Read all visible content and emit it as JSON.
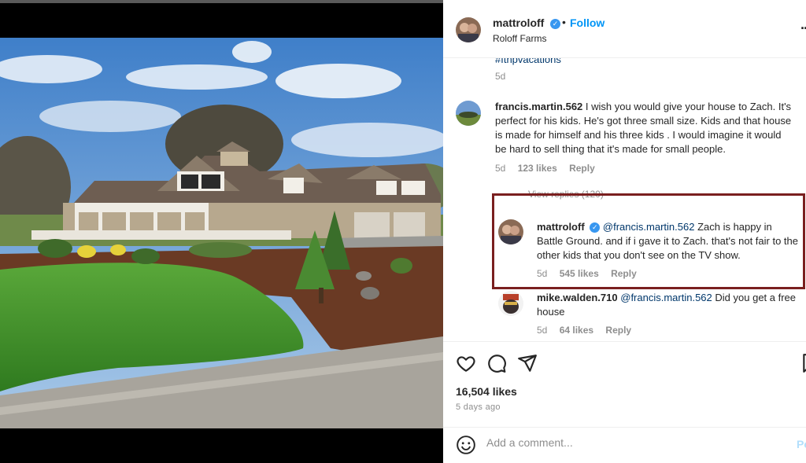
{
  "post": {
    "author": "mattroloff",
    "location": "Roloff Farms",
    "follow_label": "Follow",
    "dot": "•",
    "more_label": "···",
    "verified_mark": "✓"
  },
  "caption_tail": {
    "hashtag": "#fthpvacations",
    "time": "5d"
  },
  "comments": [
    {
      "username": "francis.martin.562",
      "text": " I wish you would give your house to Zach. It's perfect for his kids. He's got three small size. Kids and that house is made for himself and his three kids . I would imagine it would be hard to sell thing that it's made for small people.",
      "time": "5d",
      "likes": "123 likes",
      "reply": "Reply"
    },
    {
      "username": "mattroloff",
      "mention": "@francis.martin.562",
      "text": " Zach is happy in Battle Ground. and if i gave it to Zach. that's not fair to the other kids that you don't see on the TV show.",
      "time": "5d",
      "likes": "545 likes",
      "reply": "Reply"
    },
    {
      "username": "mike.walden.710",
      "mention": "@francis.martin.562",
      "text": " Did you get a free house",
      "time": "5d",
      "likes": "64 likes",
      "reply": "Reply"
    }
  ],
  "view_replies": "View replies (120)",
  "actions": {
    "icons": [
      "heart-icon",
      "comment-icon",
      "share-icon",
      "bookmark-icon"
    ]
  },
  "likes_count": "16,504 likes",
  "posted_ago": "5 days ago",
  "add_comment": {
    "placeholder": "Add a comment...",
    "post_label": "Post"
  },
  "colors": {
    "accent": "#0095f6",
    "highlight_border": "#7a1f1f",
    "verified": "#3897f0"
  }
}
